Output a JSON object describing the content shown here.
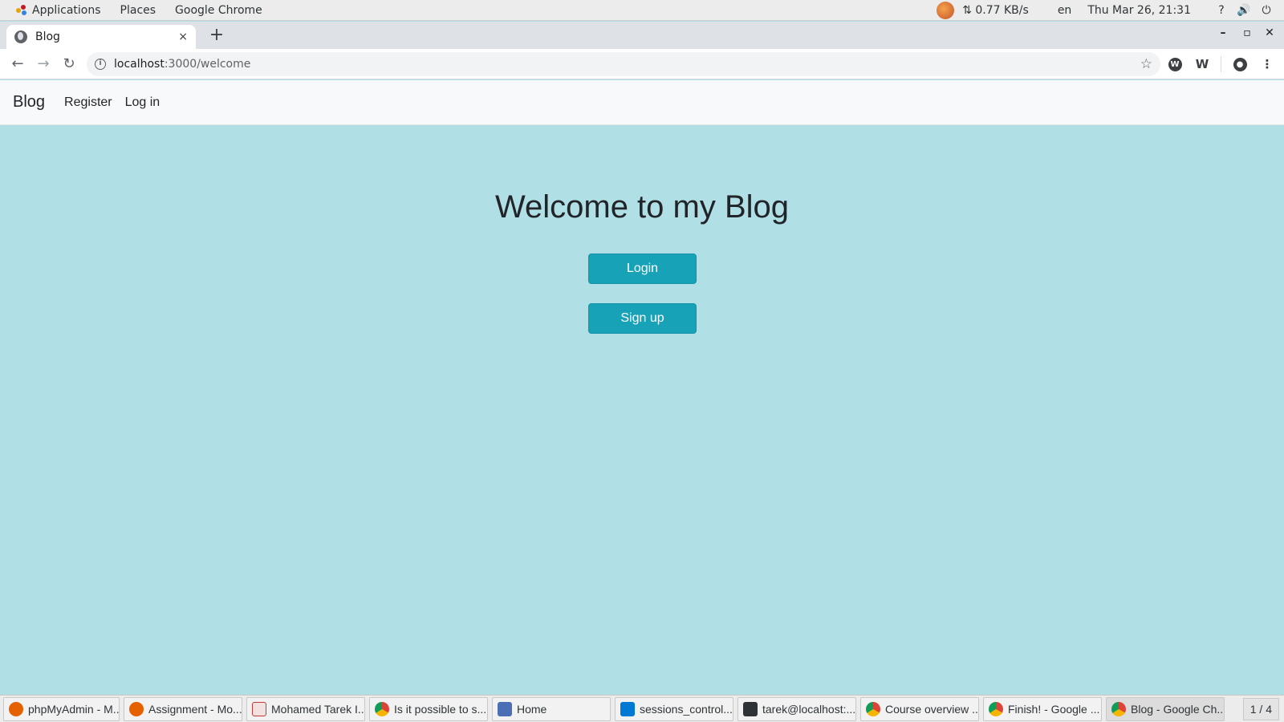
{
  "topbar": {
    "applications": "Applications",
    "places": "Places",
    "active_app": "Google Chrome",
    "network_speed": "⇅ 0.77 KB/s",
    "language": "en",
    "datetime": "Thu Mar 26, 21:31",
    "help_glyph": "?",
    "volume_glyph": "🔊",
    "power_glyph": "⏻"
  },
  "browser": {
    "tab_title": "Blog",
    "tab_close": "×",
    "new_tab": "+",
    "url_host": "localhost",
    "url_path": ":3000/welcome",
    "star_glyph": "☆",
    "window_minimize": "–",
    "window_maximize": "▫",
    "window_close": "✕",
    "back_glyph": "←",
    "forward_glyph": "→",
    "reload_glyph": "↻",
    "ext_w_label": "W",
    "ext_m_label": "W",
    "menu_glyph": "⋮",
    "profile_glyph": "●"
  },
  "site": {
    "brand": "Blog",
    "nav": [
      "Register",
      "Log in"
    ],
    "heading": "Welcome to my Blog",
    "login_button": "Login",
    "signup_button": "Sign up",
    "accent_color": "#17a2b8",
    "background_color": "#b0dfe5"
  },
  "taskbar": {
    "items": [
      {
        "label": "phpMyAdmin - M...",
        "icon": "firefox-icon",
        "color": "#e66000"
      },
      {
        "label": "Assignment - Mo...",
        "icon": "firefox-icon",
        "color": "#e66000"
      },
      {
        "label": "Mohamed Tarek I...",
        "icon": "document-viewer-icon",
        "color": "#c23b3b"
      },
      {
        "label": "Is it possible to s...",
        "icon": "chrome-icon",
        "color": "#db4437"
      },
      {
        "label": "Home",
        "icon": "file-manager-icon",
        "color": "#4a6fb5"
      },
      {
        "label": "sessions_control...",
        "icon": "vscode-icon",
        "color": "#0078d4"
      },
      {
        "label": "tarek@localhost:...",
        "icon": "terminal-icon",
        "color": "#2e3436"
      },
      {
        "label": "Course overview ...",
        "icon": "chrome-icon",
        "color": "#db4437"
      },
      {
        "label": "Finish! - Google ...",
        "icon": "chrome-icon",
        "color": "#db4437"
      },
      {
        "label": "Blog - Google Ch...",
        "icon": "chrome-icon",
        "color": "#db4437"
      }
    ],
    "workspace": "1 / 4"
  }
}
